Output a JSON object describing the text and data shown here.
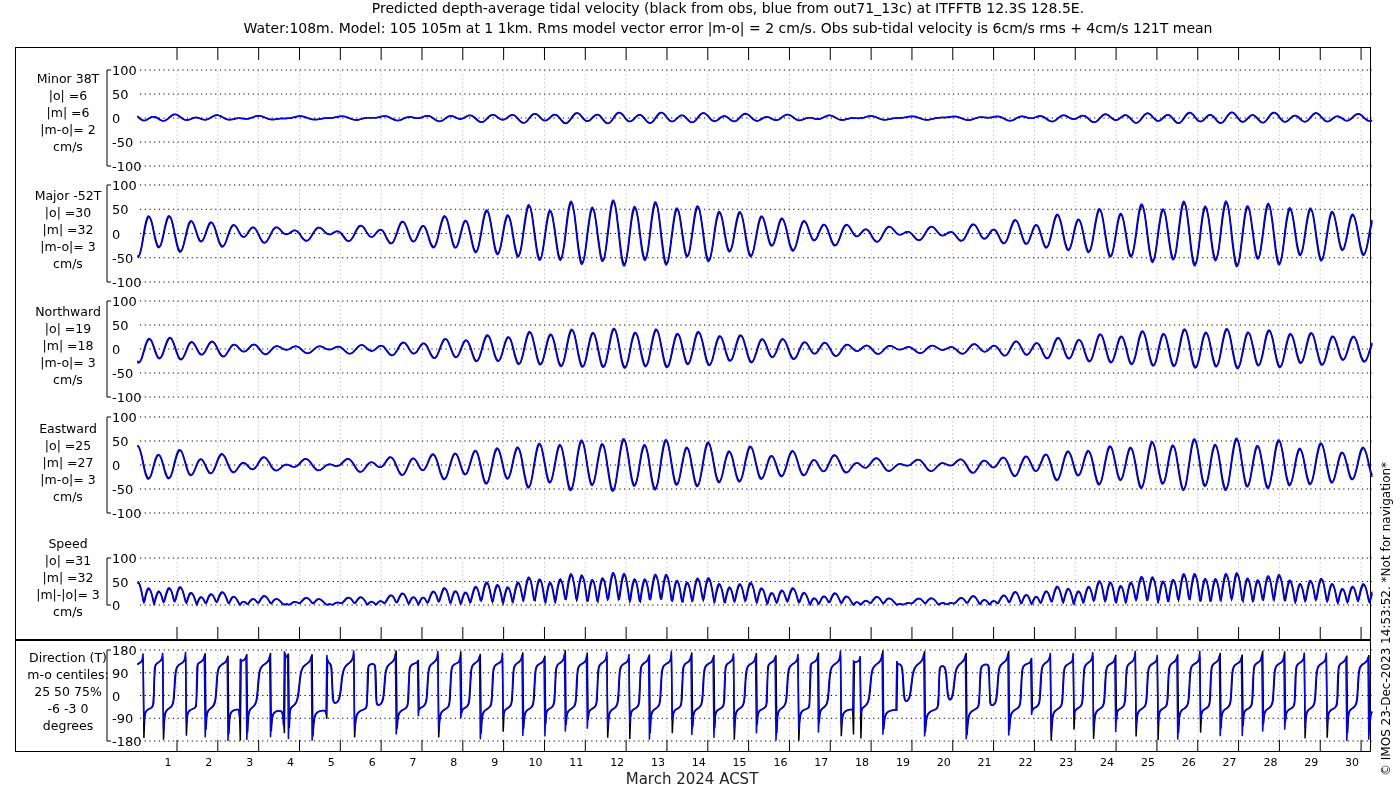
{
  "title_lines": [
    "Predicted depth-average tidal velocity (black from obs, blue from out71_13c) at ITFFTB 12.3S 128.5E.",
    "Water:108m. Model: 105 105m at 1 1km. Rms model vector error |m-o| = 2 cm/s. Obs sub-tidal velocity is 6cm/s rms + 4cm/s 121T mean"
  ],
  "panels": [
    {
      "kind": "minor",
      "label_lines": [
        "Minor 38T",
        "|o| =6",
        "|m| =6",
        "|m-o|= 2",
        "cm/s"
      ],
      "yticks": [
        "100",
        "50",
        "0",
        "-50",
        "-100"
      ]
    },
    {
      "kind": "major",
      "label_lines": [
        "Major -52T",
        "|o| =30",
        "|m| =32",
        "|m-o|= 3",
        "cm/s"
      ],
      "yticks": [
        "100",
        "50",
        "0",
        "-50",
        "-100"
      ]
    },
    {
      "kind": "northward",
      "label_lines": [
        "Northward",
        "|o| =19",
        "|m| =18",
        "|m-o|= 3",
        "cm/s"
      ],
      "yticks": [
        "100",
        "50",
        "0",
        "-50",
        "-100"
      ]
    },
    {
      "kind": "eastward",
      "label_lines": [
        "Eastward",
        "|o| =25",
        "|m| =27",
        "|m-o|= 3",
        "cm/s"
      ],
      "yticks": [
        "100",
        "50",
        "0",
        "-50",
        "-100"
      ]
    },
    {
      "kind": "speed",
      "label_lines": [
        "Speed",
        "|o| =31",
        "|m| =32",
        "|m|-|o|= 3",
        "cm/s"
      ],
      "yticks": [
        "100",
        "50",
        "0"
      ]
    },
    {
      "kind": "direction",
      "label_lines": [
        "Direction (T)",
        "m-o centiles:",
        "25  50  75%",
        "-6 -3  0",
        "degrees"
      ],
      "yticks": [
        "180",
        "90",
        "0",
        "-90",
        "-180"
      ]
    }
  ],
  "x_axis": {
    "day_labels": [
      "1",
      "2",
      "3",
      "4",
      "5",
      "6",
      "7",
      "8",
      "9",
      "10",
      "11",
      "12",
      "13",
      "14",
      "15",
      "16",
      "17",
      "18",
      "19",
      "20",
      "21",
      "22",
      "23",
      "24",
      "25",
      "26",
      "27",
      "28",
      "29",
      "30"
    ],
    "title": "March 2024 ACST"
  },
  "credit": "© IMOS 23-Dec-2023 14:53:52. *Not for navigation*"
}
